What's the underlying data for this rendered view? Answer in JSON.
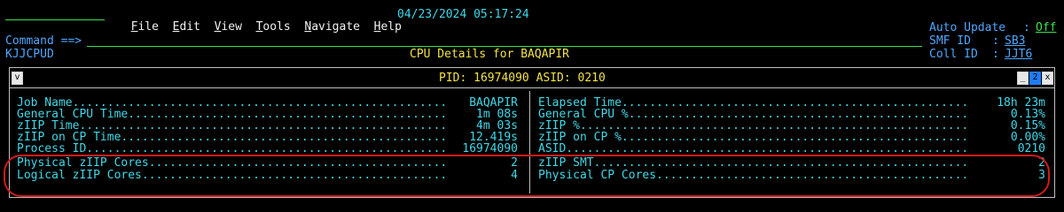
{
  "header": {
    "menu": [
      {
        "mnemonic": "F",
        "rest": "ile"
      },
      {
        "mnemonic": "E",
        "rest": "dit"
      },
      {
        "mnemonic": "V",
        "rest": "iew"
      },
      {
        "mnemonic": "T",
        "rest": "ools"
      },
      {
        "mnemonic": "N",
        "rest": "avigate"
      },
      {
        "mnemonic": "H",
        "rest": "elp"
      }
    ],
    "datetime": "04/23/2024 05:17:24",
    "command_label": "Command ==>",
    "command_value": "",
    "panel_id": "KJJCPUD",
    "screen_title": "CPU Details for BAQAPIR",
    "auto_update_label": "Auto Update",
    "auto_update_sep": ":",
    "auto_update_value": "Off",
    "smf_label": "SMF ID",
    "smf_sep": ":",
    "smf_value": "SB3",
    "coll_label": "Coll ID",
    "coll_sep": ":",
    "coll_value": "JJT6"
  },
  "panel": {
    "title": "PID: 16974090 ASID: 0210",
    "left_icon": "v",
    "right_icons": [
      "_",
      "2",
      "x"
    ]
  },
  "left_rows": [
    {
      "label": "Job Name......................................................",
      "value": "BAQAPIR"
    },
    {
      "label": "General CPU Time..............................................",
      "value": "1m 08s"
    },
    {
      "label": "zIIP Time.....................................................",
      "value": "4m 03s"
    },
    {
      "label": "zIIP on CP Time...............................................",
      "value": "12.419s"
    },
    {
      "label": "Process ID....................................................",
      "value": "16974090"
    },
    {
      "label": "Physical zIIP Cores...........................................",
      "value": "2"
    },
    {
      "label": "Logical zIIP Cores............................................",
      "value": "4"
    }
  ],
  "right_rows": [
    {
      "label": "Elapsed Time..................................................",
      "value": "18h 23m"
    },
    {
      "label": "General CPU %.................................................",
      "value": "0.13%"
    },
    {
      "label": "zIIP %........................................................",
      "value": "0.15%"
    },
    {
      "label": "zIIP on CP %..................................................",
      "value": "0.00%"
    },
    {
      "label": "ASID..........................................................",
      "value": "0210"
    },
    {
      "label": "zIIP SMT......................................................",
      "value": "2"
    },
    {
      "label": "Physical CP Cores.............................................",
      "value": "3"
    }
  ]
}
